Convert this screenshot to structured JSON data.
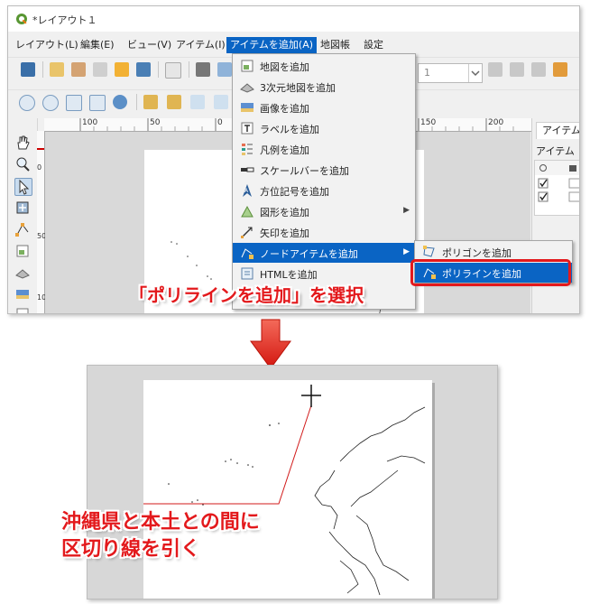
{
  "window": {
    "title": "*レイアウト１"
  },
  "menubar": {
    "items": [
      {
        "label": "レイアウト(L)"
      },
      {
        "label": "編集(E)"
      },
      {
        "label": "ビュー(V)"
      },
      {
        "label": "アイテム(I)"
      },
      {
        "label": "アイテムを追加(A)"
      },
      {
        "label": "地図帳"
      },
      {
        "label": "設定"
      }
    ],
    "active_index": 4
  },
  "toolbar": {
    "page_value": "1"
  },
  "ruler": {
    "h_labels": [
      "100",
      "50",
      "0",
      "150",
      "200"
    ],
    "v_labels": [
      "0",
      "50",
      "100"
    ]
  },
  "items_panel": {
    "tab": "アイテム",
    "title": "アイテム"
  },
  "add_item_menu": {
    "items": [
      {
        "label": "地図を追加",
        "icon": "map-icon"
      },
      {
        "label": "3次元地図を追加",
        "icon": "3d-map-icon"
      },
      {
        "label": "画像を追加",
        "icon": "picture-icon"
      },
      {
        "label": "ラベルを追加",
        "icon": "label-icon"
      },
      {
        "label": "凡例を追加",
        "icon": "legend-icon"
      },
      {
        "label": "スケールバーを追加",
        "icon": "scalebar-icon"
      },
      {
        "label": "方位記号を追加",
        "icon": "north-arrow-icon"
      },
      {
        "label": "図形を追加",
        "icon": "shape-icon",
        "submenu": true
      },
      {
        "label": "矢印を追加",
        "icon": "arrow-icon"
      },
      {
        "label": "ノードアイテムを追加",
        "icon": "node-item-icon",
        "submenu": true,
        "highlighted": true
      },
      {
        "label": "HTMLを追加",
        "icon": "html-icon"
      }
    ]
  },
  "node_submenu": {
    "items": [
      {
        "label": "ポリゴンを追加",
        "icon": "polygon-icon"
      },
      {
        "label": "ポリラインを追加",
        "icon": "polyline-icon",
        "highlighted": true
      }
    ]
  },
  "annotations": {
    "instruction": "「ポリラインを追加」を選択",
    "caption_line1": "沖縄県と本土との間に",
    "caption_line2": "区切り線を引く"
  },
  "colors": {
    "accent_red": "#e3191c",
    "menu_highlight": "#0a64c4",
    "canvas_gray": "#d7d7d7"
  }
}
